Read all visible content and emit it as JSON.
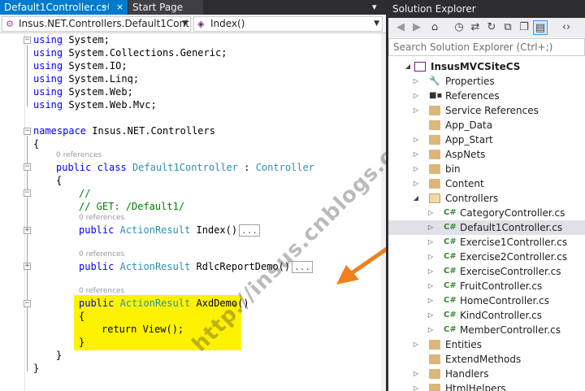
{
  "editor": {
    "active_tab": "Default1Controller.cs",
    "pin_glyph": "⊣",
    "close_glyph": "×",
    "start_tab": "Start Page",
    "nav_class": "Insus.NET.Controllers.Default1Contro",
    "nav_member": "Index()",
    "watermark": "http://insus.cnblogs.com",
    "code": {
      "usings": [
        "System",
        "System.Collections.Generic",
        "System.IO",
        "System.Linq",
        "System.Web",
        "System.Web.Mvc"
      ],
      "kw_using": "using",
      "kw_namespace": "namespace",
      "namespace_name": "Insus.NET.Controllers",
      "open_brace": "{",
      "close_brace": "}",
      "refs_label": "0 references",
      "kw_public": "public",
      "kw_class": "class",
      "class_name": "Default1Controller",
      "colon": ":",
      "base_class": "Controller",
      "comment1": "//",
      "comment2": "// GET: /Default1/",
      "return_type": "ActionResult",
      "method1": "Index()",
      "method2": "RdlcReportDemo()",
      "method3": "AxdDemo()",
      "elided": "...",
      "return_stmt": "return View();"
    }
  },
  "solution_explorer": {
    "title": "Solution Explorer",
    "search_placeholder": "Search Solution Explorer (Ctrl+;)",
    "project": "InsusMVCSiteCS",
    "items": [
      {
        "label": "Properties"
      },
      {
        "label": "References"
      },
      {
        "label": "Service References"
      },
      {
        "label": "App_Data"
      },
      {
        "label": "App_Start"
      },
      {
        "label": "AspNets"
      },
      {
        "label": "bin"
      },
      {
        "label": "Content"
      },
      {
        "label": "Controllers"
      },
      {
        "label": "CategoryController.cs"
      },
      {
        "label": "Default1Controller.cs"
      },
      {
        "label": "Exercise1Controller.cs"
      },
      {
        "label": "Exercise2Controller.cs"
      },
      {
        "label": "ExerciseController.cs"
      },
      {
        "label": "FruitController.cs"
      },
      {
        "label": "HomeController.cs"
      },
      {
        "label": "KindController.cs"
      },
      {
        "label": "MemberController.cs"
      },
      {
        "label": "Entities"
      },
      {
        "label": "ExtendMethods"
      },
      {
        "label": "Handlers"
      },
      {
        "label": "HtmlHelpers"
      }
    ],
    "cs_badge": "C#"
  },
  "colors": {
    "active_tab": "#007acc",
    "highlight": "#fff200",
    "arrow": "#f07f1e",
    "keyword": "#0000ff",
    "type": "#2b91af",
    "comment": "#008000"
  }
}
